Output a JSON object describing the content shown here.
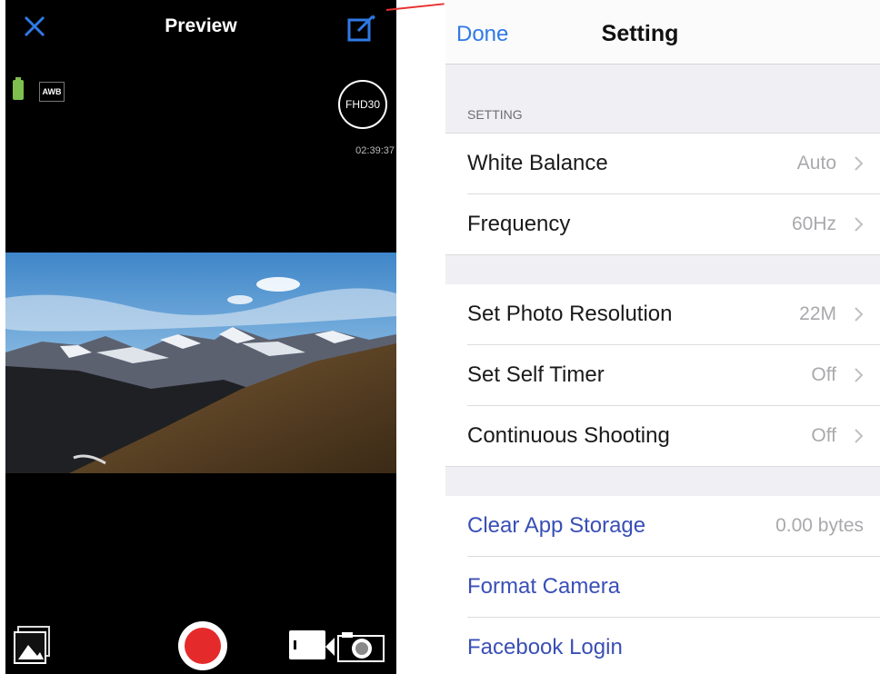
{
  "preview": {
    "title": "Preview",
    "awb_label": "AWB",
    "resolution_badge": "FHD30",
    "timer": "02:39:37",
    "icons": {
      "close": "close-icon",
      "edit": "edit-settings-icon",
      "battery": "battery-icon",
      "gallery": "gallery-icon",
      "record": "record-icon",
      "video_mode": "video-mode-icon",
      "camera_mode": "camera-switch-icon"
    },
    "colors": {
      "accent": "#2f7ae5",
      "record": "#e42a2a",
      "battery": "#7fbf4d"
    }
  },
  "settings": {
    "nav": {
      "done_label": "Done",
      "title": "Setting"
    },
    "section_header": "SETTING",
    "group1": [
      {
        "label": "White Balance",
        "value": "Auto"
      },
      {
        "label": "Frequency",
        "value": "60Hz"
      }
    ],
    "group2": [
      {
        "label": "Set Photo Resolution",
        "value": "22M"
      },
      {
        "label": "Set Self Timer",
        "value": "Off"
      },
      {
        "label": "Continuous Shooting",
        "value": "Off"
      }
    ],
    "group3": [
      {
        "label": "Clear App Storage",
        "value": "0.00 bytes"
      },
      {
        "label": "Format Camera",
        "value": ""
      },
      {
        "label": "Facebook Login",
        "value": ""
      }
    ],
    "colors": {
      "link": "#3a4fb6",
      "value": "#a9a9ad",
      "group_background": "#efeff4"
    }
  }
}
